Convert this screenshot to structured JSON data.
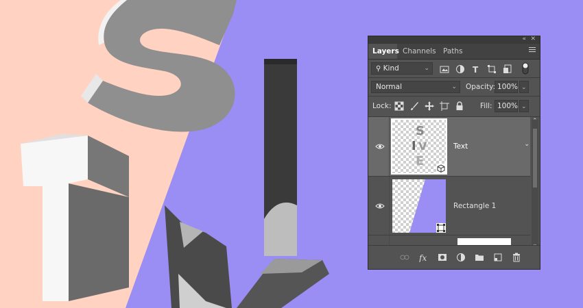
{
  "colors": {
    "canvas_left": "#ffd2c1",
    "canvas_right": "#9a8df3",
    "panel_bg": "#535353",
    "selected_layer": "#6a6a6a"
  },
  "canvas": {
    "description_icons": [
      "letter-s-3d",
      "letter-t-3d",
      "pillar-3d",
      "letter-v-3d"
    ]
  },
  "panel": {
    "tabs": [
      {
        "label": "Layers",
        "active": true
      },
      {
        "label": "Channels",
        "active": false
      },
      {
        "label": "Paths",
        "active": false
      }
    ],
    "filter": {
      "label": "Kind",
      "icons": [
        "image-filter-icon",
        "adjustment-filter-icon",
        "type-filter-icon",
        "shape-filter-icon",
        "smart-object-filter-icon",
        "filter-toggle-icon"
      ]
    },
    "blend_mode": "Normal",
    "opacity_label": "Opacity:",
    "opacity_value": "100%",
    "lock_label": "Lock:",
    "fill_label": "Fill:",
    "fill_value": "100%",
    "layers": [
      {
        "name": "Text",
        "selected": true,
        "visible": true
      },
      {
        "name": "Rectangle 1",
        "selected": false,
        "visible": true
      }
    ],
    "bottom_icons": [
      "link-layers-icon",
      "fx-icon",
      "mask-icon",
      "adjustment-layer-icon",
      "group-folder-icon",
      "new-layer-icon",
      "trash-icon"
    ]
  }
}
